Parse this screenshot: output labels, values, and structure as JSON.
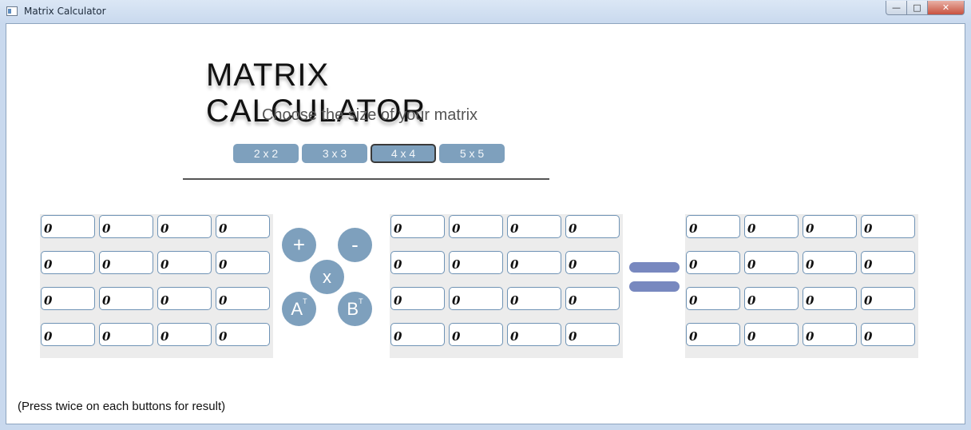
{
  "window": {
    "title": "Matrix Calculator",
    "controls": {
      "minimize": "—",
      "maximize": "□",
      "close": "✕"
    }
  },
  "header": {
    "title": "MATRIX CALCULATOR",
    "subtitle": "Choose the size of your matrix"
  },
  "size_options": [
    {
      "label": "2 x 2",
      "selected": false
    },
    {
      "label": "3 x 3",
      "selected": false
    },
    {
      "label": "4 x 4",
      "selected": true
    },
    {
      "label": "5 x 5",
      "selected": false
    }
  ],
  "matrix_a": [
    [
      "0",
      "0",
      "0",
      "0"
    ],
    [
      "0",
      "0",
      "0",
      "0"
    ],
    [
      "0",
      "0",
      "0",
      "0"
    ],
    [
      "0",
      "0",
      "0",
      "0"
    ]
  ],
  "matrix_b": [
    [
      "0",
      "0",
      "0",
      "0"
    ],
    [
      "0",
      "0",
      "0",
      "0"
    ],
    [
      "0",
      "0",
      "0",
      "0"
    ],
    [
      "0",
      "0",
      "0",
      "0"
    ]
  ],
  "result": [
    [
      "0",
      "0",
      "0",
      "0"
    ],
    [
      "0",
      "0",
      "0",
      "0"
    ],
    [
      "0",
      "0",
      "0",
      "0"
    ],
    [
      "0",
      "0",
      "0",
      "0"
    ]
  ],
  "operations": {
    "add": "+",
    "subtract": "-",
    "multiply": "x",
    "transpose_a": "A",
    "transpose_b": "B",
    "transpose_mark": "T"
  },
  "footnote": "(Press twice on each buttons for result)",
  "colors": {
    "button": "#7ea0bd",
    "equals": "#7888bf",
    "cell_border": "#6f93b5"
  }
}
